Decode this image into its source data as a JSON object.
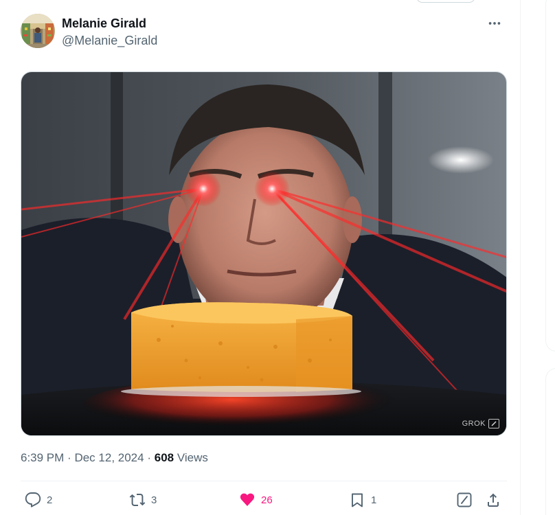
{
  "tweet": {
    "author": {
      "name": "Melanie Girald",
      "handle": "@Melanie_Girald"
    },
    "more_label": "More",
    "media": {
      "watermark": "GROK"
    },
    "time": "6:39 PM",
    "separator": "·",
    "date": "Dec 12, 2024",
    "views_count": "608",
    "views_label": "Views",
    "actions": {
      "replies": "2",
      "reposts": "3",
      "likes": "26",
      "bookmarks": "1"
    },
    "colors": {
      "like": "#f91880",
      "secondary_text": "#536471",
      "primary_text": "#0f1419"
    }
  },
  "icons": [
    "more-icon",
    "reply-icon",
    "repost-icon",
    "like-icon",
    "bookmark-icon",
    "grok-icon",
    "share-icon"
  ]
}
